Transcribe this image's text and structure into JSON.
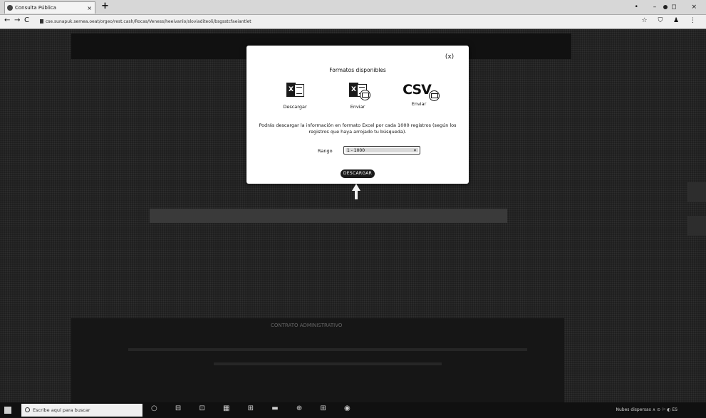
{
  "browser": {
    "tab_title": "Consulta Pública",
    "tab_close": "×",
    "new_tab": "+",
    "window_controls": "• – ◻ ×",
    "nav_back": "←",
    "nav_forward": "→",
    "nav_reload": "C",
    "url": "cse.sunapuk.semea.oeat/orgeo/rest.cash/Rocas/Veness/heeivanlo/sloviaditeoli/bsgsstcfaeiantlet",
    "addr_icons": "☆ ⛉ ♟ ⋮"
  },
  "modal": {
    "close_icon": "(x)",
    "title": "Formatos disponibles",
    "formats": [
      {
        "label": "Descargar",
        "icon": "excel-download-icon"
      },
      {
        "label": "Enviar",
        "icon": "excel-mail-icon"
      },
      {
        "label": "Enviar",
        "icon": "csv-mail-icon",
        "csv_text": "CSV"
      }
    ],
    "description": "Podrás descargar la información en formato Excel por cada 1000 registros (según los registros que haya arrojado tu búsqueda).",
    "range_label": "Rango",
    "range_value": "1 - 1000",
    "range_chevron": "▾",
    "download_button": "DESCARGAR"
  },
  "page": {
    "footer_heading": "CONTRATO ADMINISTRATIVO"
  },
  "taskbar": {
    "search_placeholder": "Escribe aquí para buscar",
    "icons": "○ ⊟ ⊡ ▦ ⊞ ▬ ⊕ ⊞ ◉",
    "tray_text": "Nubes dispersas ∧ ⊙ ⚐ ◐ ES"
  },
  "colors": {
    "overlay": "#1f1f1f",
    "modal_bg": "#ffffff",
    "button_bg": "#1a1a1a"
  }
}
